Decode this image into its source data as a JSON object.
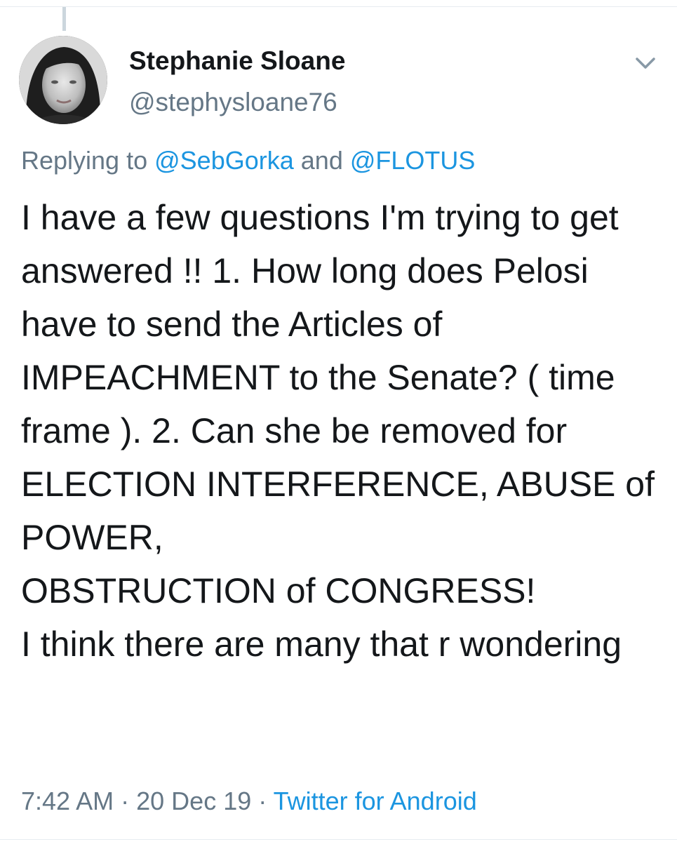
{
  "tweet": {
    "author": {
      "display_name": "Stephanie Sloane",
      "handle": "@stephysloane76"
    },
    "replying": {
      "prefix": "Replying to",
      "mention_1": "@SebGorka",
      "conjunction": "and",
      "mention_2": "@FLOTUS"
    },
    "text": "I have a few questions I'm trying to get answered !! 1. How long does Pelosi have to send the Articles of IMPEACHMENT to the Senate? ( time frame ). 2. Can she be removed for ELECTION INTERFERENCE, ABUSE of POWER,\nOBSTRUCTION of CONGRESS!\nI think there are many that r wondering",
    "time": "7:42 AM",
    "separator": "·",
    "date": "20 Dec 19",
    "source": "Twitter for Android"
  },
  "icons": {
    "menu_caret": "chevron-down-icon"
  },
  "colors": {
    "link": "#1b95e0",
    "secondary_text": "#657786",
    "primary_text": "#14171a",
    "divider": "#e6ecf0"
  }
}
